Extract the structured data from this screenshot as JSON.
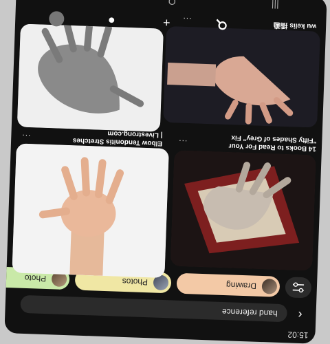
{
  "status": {
    "time": "15:02"
  },
  "search": {
    "query": "hand reference",
    "back_icon": "back-arrow-icon"
  },
  "filters": {
    "filter_icon": "sliders-icon",
    "chips": [
      {
        "label": "Drawing",
        "color": "#f3c9a6"
      },
      {
        "label": "Photos",
        "color": "#f0e7a4"
      },
      {
        "label": "Photo",
        "color": "#c9e9a8"
      }
    ]
  },
  "pins": [
    {
      "caption_1": "14 Books to Read For Your",
      "caption_2": "\"Fifty Shades of Grey\" Fix",
      "more": "..."
    },
    {
      "caption_1": "Elbow Tendonitis Stretches",
      "caption_2": "| Livestrong.com",
      "more": "..."
    },
    {
      "caption_1": "wu  kelis 插画",
      "more": "..."
    },
    {
      "caption_1": "",
      "more": ""
    }
  ],
  "nav": {
    "home": "home-icon",
    "search": "search-icon",
    "create": "plus-icon",
    "messages": "chat-icon",
    "profile": "avatar"
  },
  "system": {
    "back": "<",
    "home": "O",
    "recent": "|||"
  }
}
